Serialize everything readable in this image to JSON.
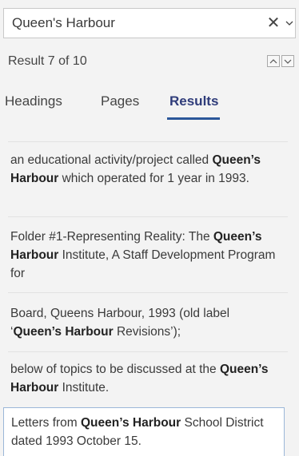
{
  "search": {
    "value": "Queen's Harbour",
    "clear_glyph": "✕",
    "clear_icon": "close-icon",
    "dropdown_icon": "chevron-down-icon"
  },
  "navigation": {
    "result_count": "Result 7 of 10",
    "prev_icon": "chevron-up-icon",
    "next_icon": "chevron-down-icon"
  },
  "tabs": [
    {
      "label": "Headings",
      "active": false
    },
    {
      "label": "Pages",
      "active": false
    },
    {
      "label": "Results",
      "active": true
    }
  ],
  "colors": {
    "accent": "#2b579a",
    "panel_bg": "#f3f3f3",
    "selected_border": "#9bb7d8"
  },
  "results": [
    {
      "before": "an educational activity/project called ",
      "match": "Queen’s Harbour",
      "after": " which operated for 1 year in 1993."
    },
    {
      "before": "Folder #1-Representing Reality: The ",
      "match": "Queen’s Harbour",
      "after": " Institute, A Staff Development Program for"
    },
    {
      "before": "Board, Queens Harbour, 1993  (old label ‘",
      "match": "Queen’s Harbour",
      "after": " Revisions’);"
    },
    {
      "before": "below of topics to be discussed at the ",
      "match": "Queen’s Harbour",
      "after": " Institute."
    },
    {
      "before": "Letters from ",
      "match": "Queen’s Harbour",
      "after": " School District dated 1993 October 15.",
      "selected": true
    }
  ]
}
